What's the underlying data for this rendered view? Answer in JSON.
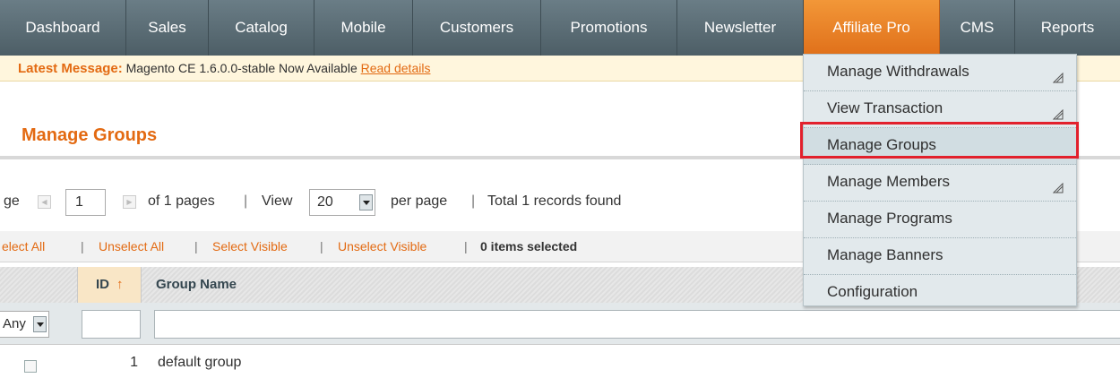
{
  "nav": {
    "items": [
      {
        "label": "Dashboard"
      },
      {
        "label": "Sales"
      },
      {
        "label": "Catalog"
      },
      {
        "label": "Mobile"
      },
      {
        "label": "Customers"
      },
      {
        "label": "Promotions"
      },
      {
        "label": "Newsletter"
      },
      {
        "label": "Affiliate Pro"
      },
      {
        "label": "CMS"
      },
      {
        "label": "Reports"
      }
    ],
    "active": "Affiliate Pro",
    "accent_color": "#e8781f"
  },
  "message": {
    "label": "Latest Message:",
    "text": "Magento CE 1.6.0.0-stable Now Available",
    "link": "Read details"
  },
  "page_title": "Manage Groups",
  "pager": {
    "prefix": "ge",
    "page": "1",
    "of_pages": "of 1 pages",
    "sep1": "|",
    "view_label": "View",
    "per_page_value": "20",
    "per_page_label": "per page",
    "sep2": "|",
    "total": "Total 1 records found"
  },
  "massaction": {
    "select_all": "elect All",
    "unselect_all": "Unselect All",
    "select_visible": "Select Visible",
    "unselect_visible": "Unselect Visible",
    "sep": "|",
    "count": "0 items selected"
  },
  "grid": {
    "columns": {
      "id": "ID",
      "group_name": "Group Name"
    },
    "sort_indicator": "↑",
    "filter_any": "Any",
    "rows": [
      {
        "id": "1",
        "group_name": "default group"
      }
    ]
  },
  "dropdown": {
    "items": [
      {
        "label": "Manage Withdrawals",
        "has_sub": true
      },
      {
        "label": "View Transaction",
        "has_sub": true
      },
      {
        "label": "Manage Groups",
        "has_sub": false
      },
      {
        "label": "Manage Members",
        "has_sub": true
      },
      {
        "label": "Manage Programs",
        "has_sub": false
      },
      {
        "label": "Manage Banners",
        "has_sub": false
      },
      {
        "label": "Configuration",
        "has_sub": false
      }
    ],
    "highlighted": "Manage Groups",
    "highlight_color": "#e2202c"
  }
}
